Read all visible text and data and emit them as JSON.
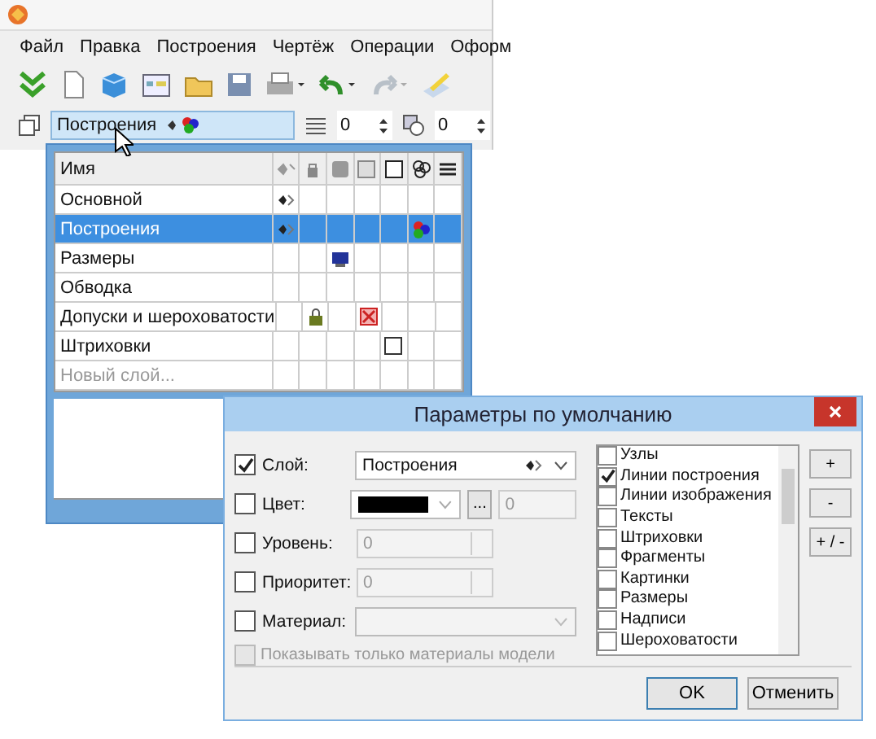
{
  "menu": [
    "Файл",
    "Правка",
    "Построения",
    "Чертёж",
    "Операции",
    "Оформ"
  ],
  "layer_bar": {
    "layer": "Построения",
    "level": "0",
    "priority": "0"
  },
  "layers_table": {
    "columns": [
      "Имя"
    ],
    "rows": [
      {
        "name": "Основной",
        "selected": false,
        "kind": "layer",
        "cells": [
          {
            "kind": "arrows"
          },
          {
            "kind": "empty"
          },
          {
            "kind": "empty"
          },
          {
            "kind": "empty"
          },
          {
            "kind": "empty"
          },
          {
            "kind": "empty"
          },
          {
            "kind": "empty"
          }
        ]
      },
      {
        "name": "Построения",
        "selected": true,
        "kind": "layer",
        "cells": [
          {
            "kind": "arrows"
          },
          {
            "kind": "empty"
          },
          {
            "kind": "empty"
          },
          {
            "kind": "empty"
          },
          {
            "kind": "empty"
          },
          {
            "kind": "colors"
          },
          {
            "kind": "empty"
          }
        ]
      },
      {
        "name": "Размеры",
        "selected": false,
        "kind": "layer",
        "cells": [
          {
            "kind": "empty"
          },
          {
            "kind": "empty"
          },
          {
            "kind": "monitor"
          },
          {
            "kind": "empty"
          },
          {
            "kind": "empty"
          },
          {
            "kind": "empty"
          },
          {
            "kind": "empty"
          }
        ]
      },
      {
        "name": "Обводка",
        "selected": false,
        "kind": "layer",
        "cells": [
          {
            "kind": "empty"
          },
          {
            "kind": "empty"
          },
          {
            "kind": "empty"
          },
          {
            "kind": "empty"
          },
          {
            "kind": "empty"
          },
          {
            "kind": "empty"
          },
          {
            "kind": "empty"
          }
        ]
      },
      {
        "name": "Допуски и шероховатости",
        "selected": false,
        "kind": "layer",
        "cells": [
          {
            "kind": "empty"
          },
          {
            "kind": "lock"
          },
          {
            "kind": "empty"
          },
          {
            "kind": "cross"
          },
          {
            "kind": "empty"
          },
          {
            "kind": "empty"
          },
          {
            "kind": "empty"
          }
        ]
      },
      {
        "name": "Штриховки",
        "selected": false,
        "kind": "layer",
        "cells": [
          {
            "kind": "empty"
          },
          {
            "kind": "empty"
          },
          {
            "kind": "empty"
          },
          {
            "kind": "empty"
          },
          {
            "kind": "square"
          },
          {
            "kind": "empty"
          },
          {
            "kind": "empty"
          }
        ]
      },
      {
        "name": "Новый слой...",
        "selected": false,
        "kind": "new",
        "cells": [
          {
            "kind": "empty"
          },
          {
            "kind": "empty"
          },
          {
            "kind": "empty"
          },
          {
            "kind": "empty"
          },
          {
            "kind": "empty"
          },
          {
            "kind": "empty"
          },
          {
            "kind": "empty"
          }
        ]
      }
    ]
  },
  "dialog": {
    "title": "Параметры по умолчанию",
    "fields": [
      {
        "kind": "layer",
        "label": "Слой:",
        "checked": true,
        "value": "Построения"
      },
      {
        "kind": "color",
        "label": "Цвет:",
        "checked": false,
        "button": "...",
        "value": "0"
      },
      {
        "kind": "spin",
        "label": "Уровень:",
        "checked": false,
        "value": "0"
      },
      {
        "kind": "spin",
        "label": "Приоритет:",
        "checked": false,
        "value": "0"
      },
      {
        "kind": "combo",
        "label": "Материал:",
        "checked": false
      }
    ],
    "model_only": {
      "label": "Показывать только материалы модели",
      "checked": false,
      "disabled": true
    },
    "object_types": [
      {
        "label": "Узлы",
        "checked": false
      },
      {
        "label": "Линии построения",
        "checked": true
      },
      {
        "label": "Линии изображения",
        "checked": false
      },
      {
        "label": "Тексты",
        "checked": false
      },
      {
        "label": "Штриховки",
        "checked": false
      },
      {
        "label": "Фрагменты",
        "checked": false
      },
      {
        "label": "Картинки",
        "checked": false
      },
      {
        "label": "Размеры",
        "checked": false
      },
      {
        "label": "Надписи",
        "checked": false
      },
      {
        "label": "Шероховатости",
        "checked": false
      }
    ],
    "side_buttons": [
      "+",
      "-",
      "+ / -"
    ],
    "buttons": [
      "OK",
      "Отменить"
    ]
  }
}
